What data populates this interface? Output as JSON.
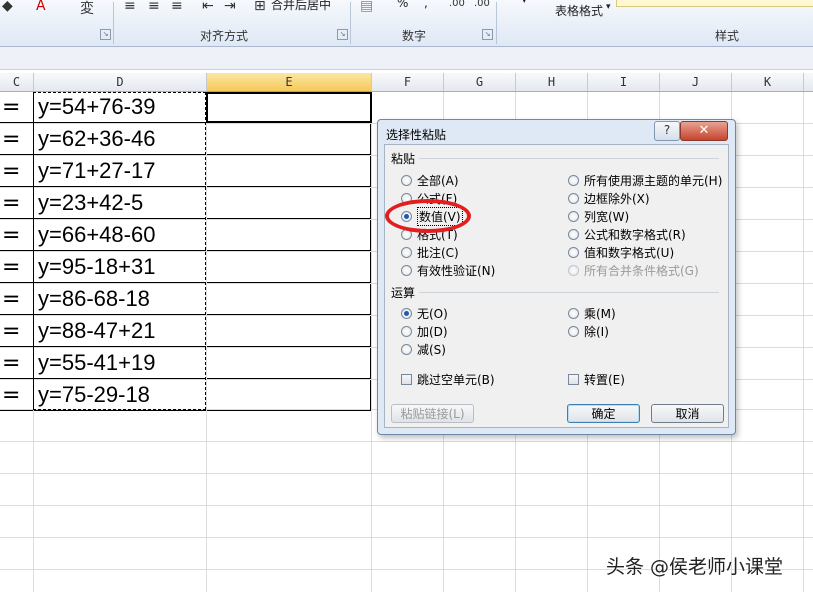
{
  "ribbon": {
    "groups": [
      {
        "label": "对齐方式"
      },
      {
        "label": "数字"
      },
      {
        "label": "样式"
      }
    ],
    "merge_center": "合并后居中",
    "table_format": "表格格式",
    "percent": "%",
    "comma": ","
  },
  "columns": [
    "C",
    "D",
    "E",
    "F",
    "G",
    "H",
    "I",
    "J",
    "K"
  ],
  "rows": [
    {
      "c": "=",
      "d": "y=54+76-39"
    },
    {
      "c": "=",
      "d": "y=62+36-46"
    },
    {
      "c": "=",
      "d": "y=71+27-17"
    },
    {
      "c": "=",
      "d": "y=23+42-5"
    },
    {
      "c": "=",
      "d": "y=66+48-60"
    },
    {
      "c": "=",
      "d": "y=95-18+31"
    },
    {
      "c": "=",
      "d": "y=86-68-18"
    },
    {
      "c": "=",
      "d": "y=88-47+21"
    },
    {
      "c": "=",
      "d": "y=55-41+19"
    },
    {
      "c": "=",
      "d": "y=75-29-18"
    }
  ],
  "dialog": {
    "title": "选择性粘贴",
    "help": "?",
    "close": "✕",
    "paste_section": "粘贴",
    "paste_left": [
      {
        "label": "全部(A)",
        "selected": false
      },
      {
        "label": "公式(F)",
        "selected": false
      },
      {
        "label": "数值(V)",
        "selected": true
      },
      {
        "label": "格式(T)",
        "selected": false
      },
      {
        "label": "批注(C)",
        "selected": false
      },
      {
        "label": "有效性验证(N)",
        "selected": false
      }
    ],
    "paste_right": [
      {
        "label": "所有使用源主题的单元(H)",
        "disabled": false
      },
      {
        "label": "边框除外(X)",
        "disabled": false
      },
      {
        "label": "列宽(W)",
        "disabled": false
      },
      {
        "label": "公式和数字格式(R)",
        "disabled": false
      },
      {
        "label": "值和数字格式(U)",
        "disabled": false
      },
      {
        "label": "所有合并条件格式(G)",
        "disabled": true
      }
    ],
    "operation_section": "运算",
    "op_left": [
      {
        "label": "无(O)",
        "selected": true
      },
      {
        "label": "加(D)",
        "selected": false
      },
      {
        "label": "减(S)",
        "selected": false
      }
    ],
    "op_right": [
      {
        "label": "乘(M)",
        "selected": false
      },
      {
        "label": "除(I)",
        "selected": false
      }
    ],
    "skip_blanks": "跳过空单元(B)",
    "transpose": "转置(E)",
    "paste_link": "粘贴链接(L)",
    "ok": "确定",
    "cancel": "取消"
  },
  "watermark": "头条 @侯老师小课堂",
  "colors": {
    "highlight_ellipse": "#e21e1e",
    "selected_col_header": "#f6c95a",
    "dialog_bg": "#dfe9f5"
  }
}
